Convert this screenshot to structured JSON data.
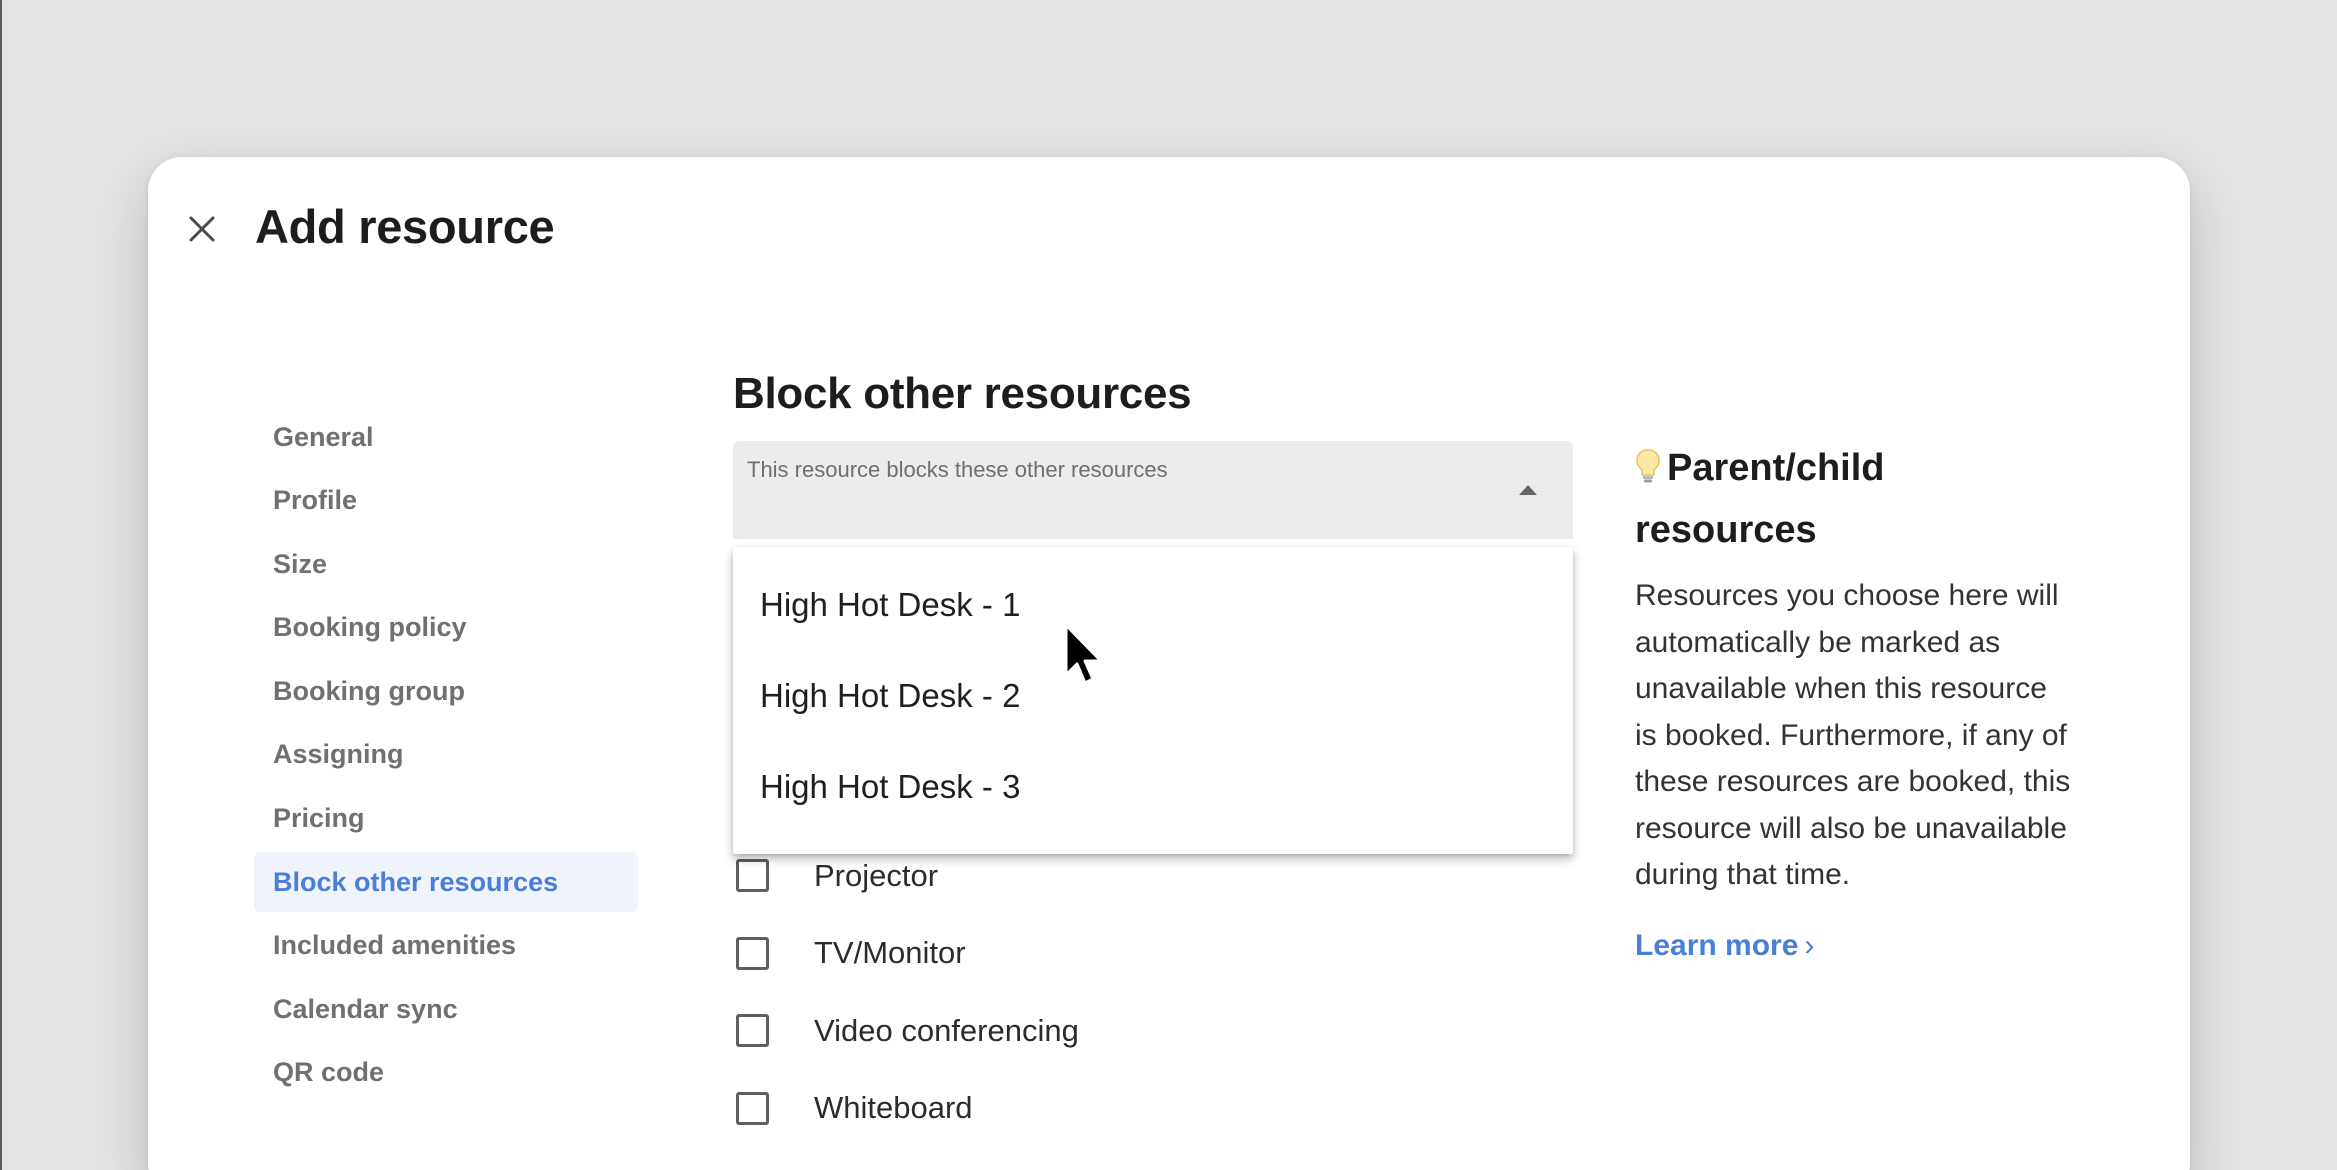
{
  "modal": {
    "title": "Add resource",
    "close_icon": "close-icon"
  },
  "nav": {
    "items": [
      {
        "label": "General"
      },
      {
        "label": "Profile"
      },
      {
        "label": "Size"
      },
      {
        "label": "Booking policy"
      },
      {
        "label": "Booking group"
      },
      {
        "label": "Assigning"
      },
      {
        "label": "Pricing"
      },
      {
        "label": "Block other resources",
        "active": true
      },
      {
        "label": "Included amenities"
      },
      {
        "label": "Calendar sync"
      },
      {
        "label": "QR code"
      }
    ]
  },
  "section": {
    "title": "Block other resources"
  },
  "select": {
    "label": "This resource blocks these other resources",
    "arrow_icon": "caret-up-icon",
    "options": [
      "High Hot Desk - 1",
      "High Hot Desk - 2",
      "High Hot Desk - 3"
    ]
  },
  "amenities": {
    "items": [
      "Projector",
      "TV/Monitor",
      "Video conferencing",
      "Whiteboard"
    ]
  },
  "info": {
    "icon": "lightbulb-icon",
    "title": "Parent/child resources",
    "body": "Resources you choose here will automatically be marked as unavailable when this resource is booked. Furthermore, if any of these resources are booked, this resource will also be unavailable during that time.",
    "link_label": "Learn more",
    "link_chevron": "›"
  },
  "colors": {
    "accent": "#4a7fd6",
    "active_nav_bg": "#eef3fc",
    "page_bg": "#e4e4e4"
  }
}
